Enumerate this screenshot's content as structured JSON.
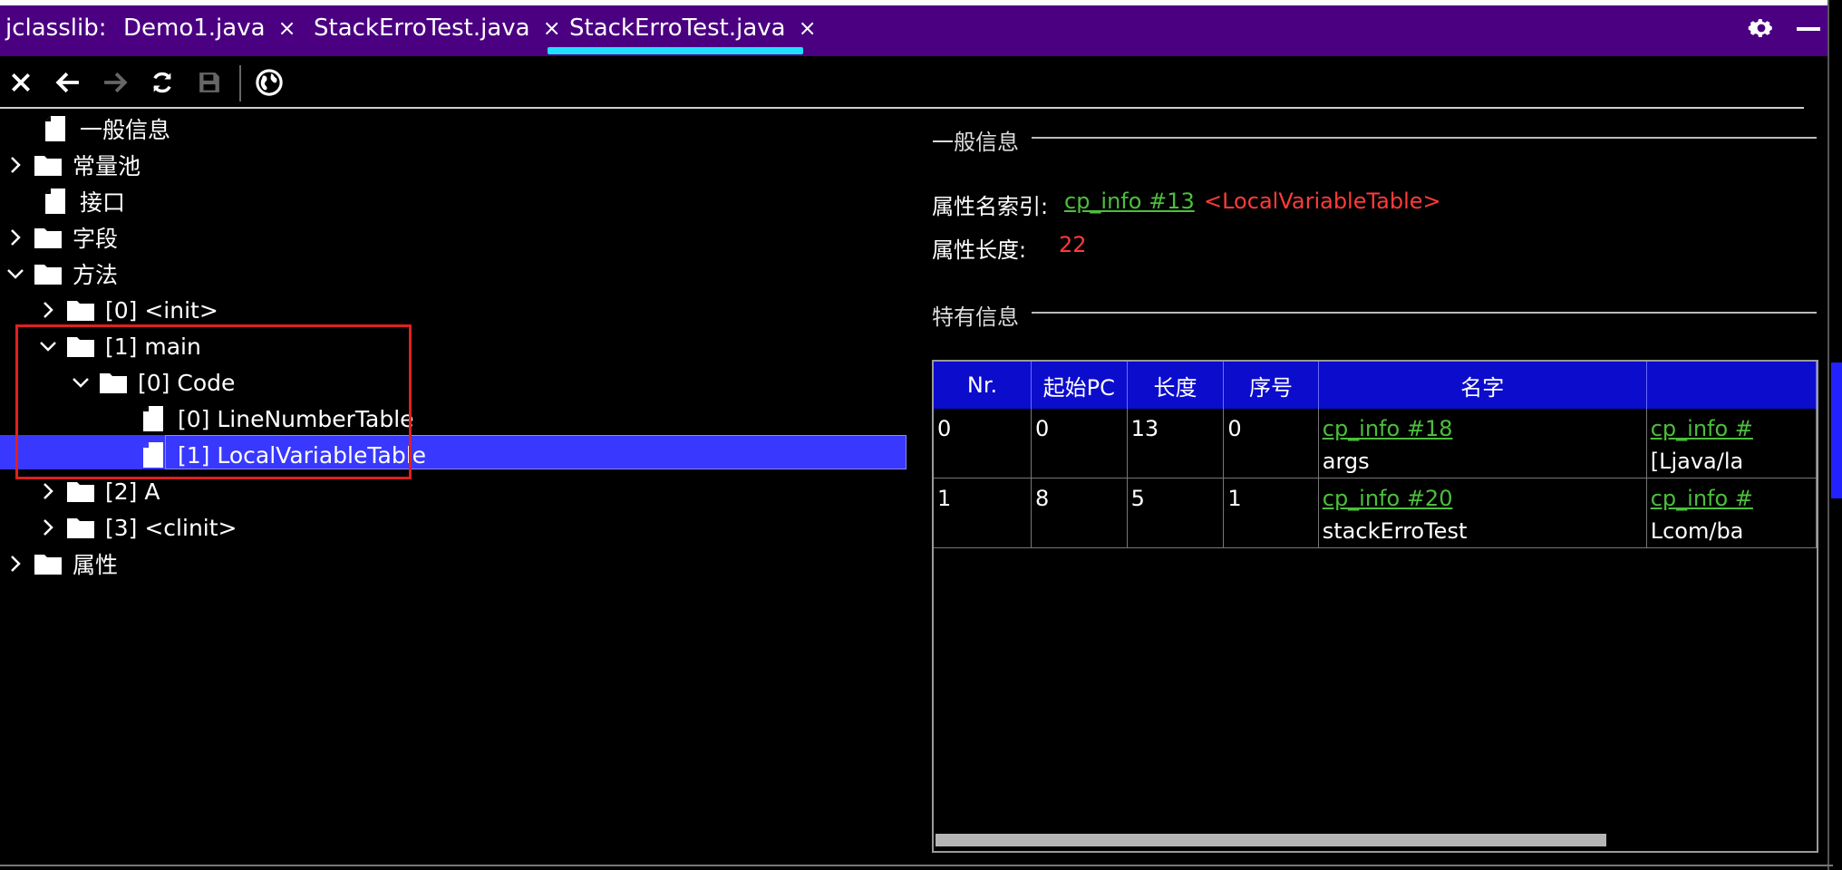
{
  "window": {
    "app_name": "jclasslib:",
    "tabs": [
      {
        "label": "Demo1.java",
        "close": "×"
      },
      {
        "label": "StackErroTest.java",
        "close": "×"
      },
      {
        "label": "StackErroTest.java",
        "close": "×",
        "active": true
      }
    ],
    "settings_icon": "gear-icon",
    "minimize": "—",
    "accent_color": "#1fe0ff",
    "titlebar_color": "#4b0082"
  },
  "toolbar": {
    "icons": [
      "close-icon",
      "back-arrow-icon",
      "forward-arrow-icon",
      "refresh-icon",
      "save-icon",
      "globe-icon"
    ]
  },
  "tree": {
    "items": [
      {
        "label": "一般信息",
        "type": "file"
      },
      {
        "label": "常量池",
        "type": "folder",
        "expanded": false
      },
      {
        "label": "接口",
        "type": "file"
      },
      {
        "label": "字段",
        "type": "folder",
        "expanded": false
      },
      {
        "label": "方法",
        "type": "folder",
        "expanded": true
      },
      {
        "label": "[0] <init>",
        "type": "folder",
        "expanded": false
      },
      {
        "label": "[1] main",
        "type": "folder",
        "expanded": true
      },
      {
        "label": "[0] Code",
        "type": "folder",
        "expanded": true
      },
      {
        "label": "[0] LineNumberTable",
        "type": "file"
      },
      {
        "label": "[1] LocalVariableTable",
        "type": "file",
        "selected": true
      },
      {
        "label": "[2] A",
        "type": "folder",
        "expanded": false
      },
      {
        "label": "[3] <clinit>",
        "type": "folder",
        "expanded": false
      },
      {
        "label": "属性",
        "type": "folder",
        "expanded": false
      }
    ],
    "selection_color": "#3838ff",
    "highlight_box_color": "#e02020"
  },
  "detail": {
    "general_title": "一般信息",
    "attr_name_index_label": "属性名索引:",
    "attr_name_index_link": "cp_info #13",
    "attr_name_index_value": "<LocalVariableTable>",
    "attr_length_label": "属性长度:",
    "attr_length_value": "22",
    "specific_title": "特有信息",
    "table": {
      "headers": [
        "Nr.",
        "起始PC",
        "长度",
        "序号",
        "名字",
        ""
      ],
      "rows": [
        {
          "nr": "0",
          "start_pc": "0",
          "length": "13",
          "index": "0",
          "name_link": "cp_info #18",
          "name": "args",
          "desc_link": "cp_info #",
          "desc": "[Ljava/la"
        },
        {
          "nr": "1",
          "start_pc": "8",
          "length": "5",
          "index": "1",
          "name_link": "cp_info #20",
          "name": "stackErroTest",
          "desc_link": "cp_info #",
          "desc": "Lcom/ba"
        }
      ]
    }
  }
}
